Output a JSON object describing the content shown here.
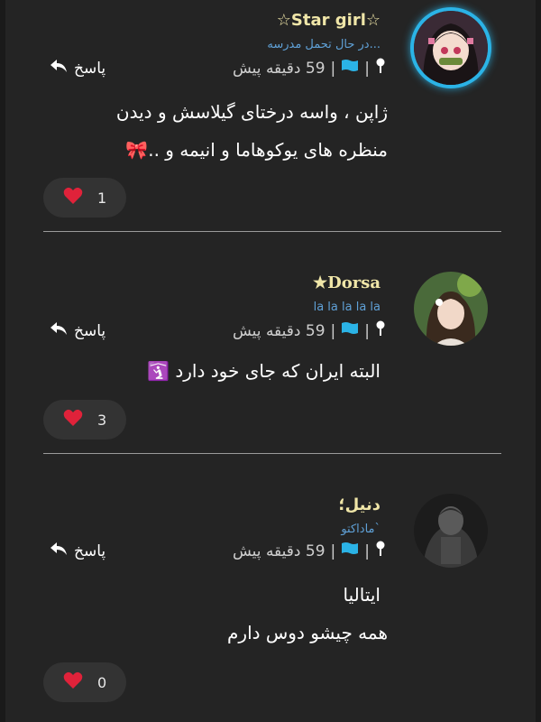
{
  "comments": [
    {
      "username": "☆Star girl☆",
      "subtitle": "در حال تحمل مدرسه...",
      "time": "59 دقیقه پیش",
      "reply_label": "پاسخ",
      "body": [
        "ژاپن ، واسه درختای گیلاسش و دیدن",
        "منظره های یوکوهاما و انیمه و ..🎀"
      ],
      "likes": "1",
      "username_color": "#f0e6a8",
      "avatar_ring": "#2bb3e6"
    },
    {
      "username": "★Dorsa",
      "subtitle": "la la la la la",
      "time": "59 دقیقه پیش",
      "reply_label": "پاسخ",
      "body": [
        "البته ایران که جای خود دارد 🛐"
      ],
      "likes": "3",
      "username_color": "#f0e6a8"
    },
    {
      "username": "دنیل؛",
      "subtitle": "ماداکتو`",
      "time": "59 دقیقه پیش",
      "reply_label": "پاسخ",
      "body": [
        "ایتالیا",
        "همه چیشو دوس دارم"
      ],
      "likes": "0",
      "username_color": "#f0e6a8"
    }
  ],
  "icons": {
    "pin": "pin-icon",
    "flag": "flag-icon",
    "reply": "reply-arrow-icon",
    "heart": "heart-icon"
  },
  "colors": {
    "background": "#242424",
    "accent_blue": "#2bb3e6",
    "subtitle_blue": "#5fa0d6",
    "heart_red": "#e0223a"
  }
}
